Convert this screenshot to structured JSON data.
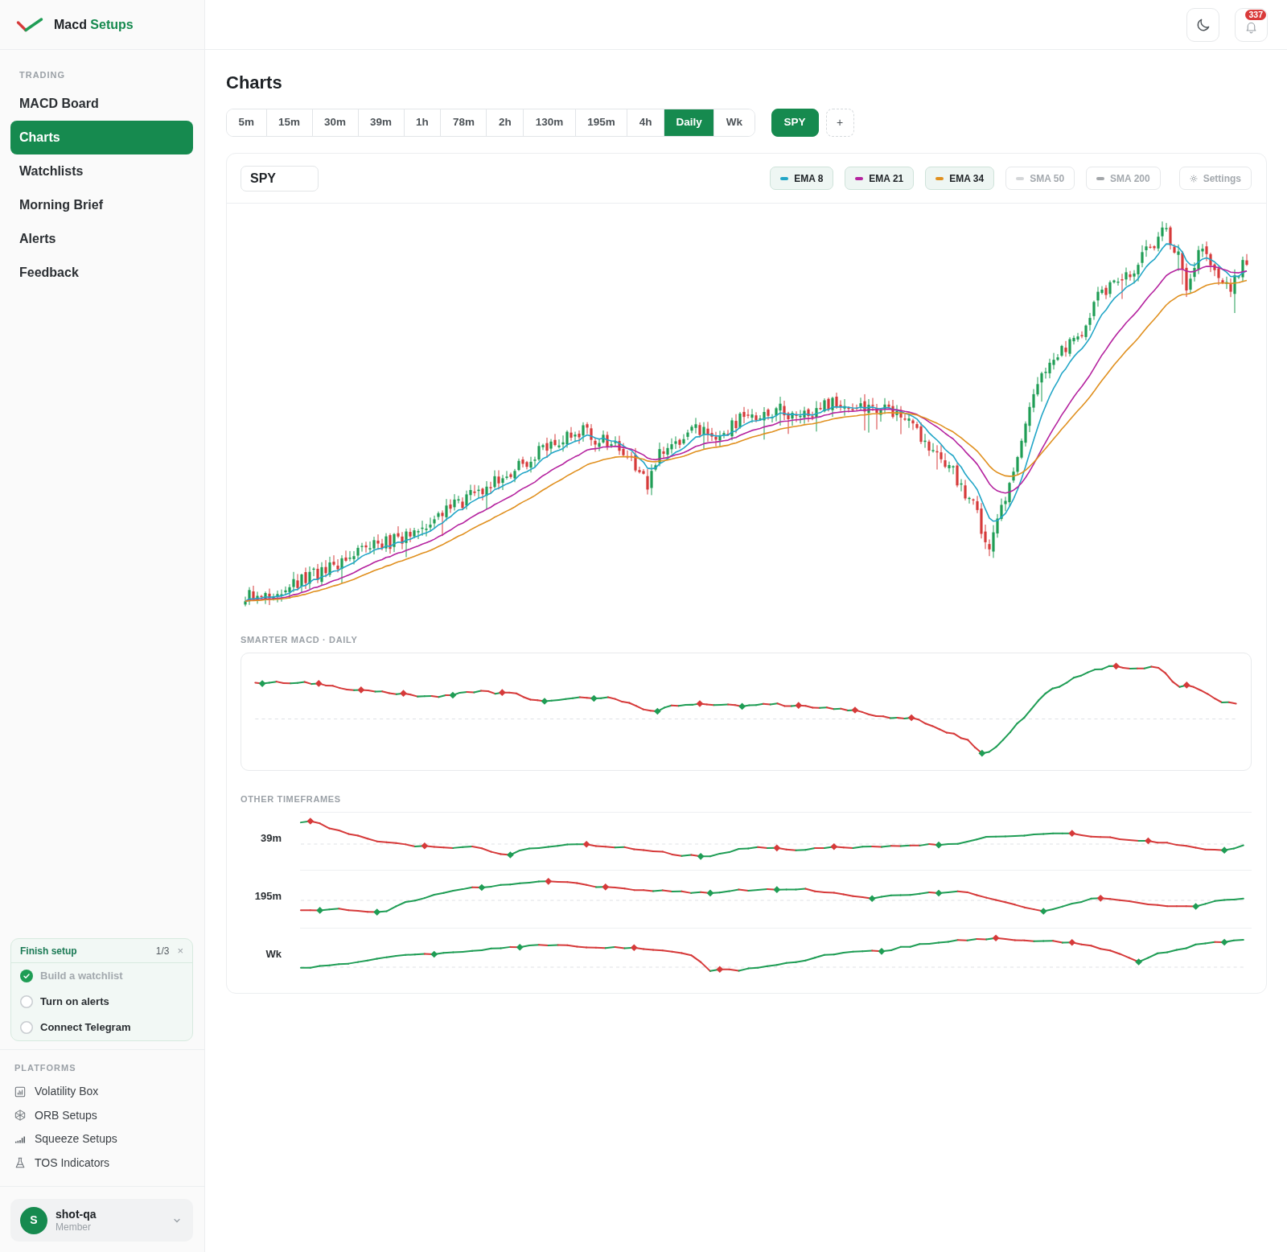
{
  "sidebar": {
    "brand": {
      "name": "Macd",
      "accent": "Setups"
    },
    "trading": {
      "heading": "TRADING",
      "items": [
        {
          "label": "MACD Board",
          "selected": false
        },
        {
          "label": "Charts",
          "selected": true
        },
        {
          "label": "Watchlists",
          "selected": false
        },
        {
          "label": "Morning Brief",
          "selected": false
        },
        {
          "label": "Alerts",
          "selected": false
        },
        {
          "label": "Feedback",
          "selected": false
        }
      ]
    },
    "setup": {
      "title": "Finish setup",
      "count": "1/3",
      "close": "×",
      "items": [
        {
          "label": "Build a watchlist",
          "checked": true
        },
        {
          "label": "Turn on alerts",
          "checked": false
        },
        {
          "label": "Connect Telegram",
          "checked": false
        }
      ]
    },
    "platforms": {
      "heading": "PLATFORMS",
      "items": [
        {
          "label": "Volatility Box"
        },
        {
          "label": "ORB Setups"
        },
        {
          "label": "Squeeze Setups"
        },
        {
          "label": "TOS Indicators"
        }
      ]
    },
    "user": {
      "initial": "S",
      "name": "shot-qa",
      "role": "Member"
    }
  },
  "header": {
    "notifications": "337"
  },
  "page": {
    "title": "Charts",
    "timeframes": [
      {
        "label": "5m",
        "selected": false
      },
      {
        "label": "15m",
        "selected": false
      },
      {
        "label": "30m",
        "selected": false
      },
      {
        "label": "39m",
        "selected": false
      },
      {
        "label": "1h",
        "selected": false
      },
      {
        "label": "78m",
        "selected": false
      },
      {
        "label": "2h",
        "selected": false
      },
      {
        "label": "130m",
        "selected": false
      },
      {
        "label": "195m",
        "selected": false
      },
      {
        "label": "4h",
        "selected": false
      },
      {
        "label": "Daily",
        "selected": true
      },
      {
        "label": "Wk",
        "selected": false
      }
    ],
    "symbols": [
      {
        "label": "SPY",
        "selected": true
      }
    ],
    "add": "+"
  },
  "chart": {
    "symbol": "SPY",
    "indicators": [
      {
        "label": "EMA 8",
        "color": "#22a6c7",
        "on": true
      },
      {
        "label": "EMA 21",
        "color": "#b5239f",
        "on": true
      },
      {
        "label": "EMA 34",
        "color": "#e0901f",
        "on": true
      },
      {
        "label": "SMA 50",
        "color": "#d4d6d8",
        "on": false
      },
      {
        "label": "SMA 200",
        "color": "#a3a6a9",
        "on": false
      }
    ],
    "settings": "Settings",
    "macd": {
      "title": "SMARTER MACD · DAILY"
    },
    "other": {
      "heading": "OTHER TIMEFRAMES",
      "rows": [
        {
          "label": "39m"
        },
        {
          "label": "195m"
        },
        {
          "label": "Wk"
        }
      ]
    }
  }
}
